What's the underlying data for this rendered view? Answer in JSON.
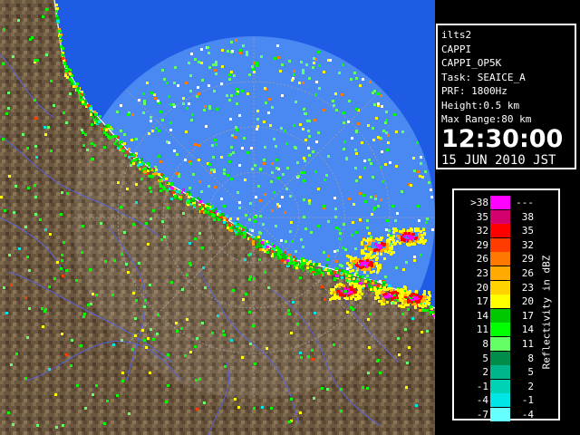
{
  "info": {
    "station": "ilts2",
    "product": "CAPPI",
    "product_code": "CAPPI_OP5K",
    "task": "Task: SEAICE_A",
    "prf": "PRF: 1800Hz",
    "height": "Height:0.5 km",
    "max_range": "Max Range:80 km",
    "time": "12:30:00",
    "date": "15 JUN 2010 JST"
  },
  "legend": {
    "title": "Reflectivity in dBZ",
    "rows": [
      {
        "lo": ">38",
        "hi": "---",
        "color": "#ff00ff"
      },
      {
        "lo": "35",
        "hi": "38",
        "color": "#d4006e"
      },
      {
        "lo": "32",
        "hi": "35",
        "color": "#ff0000"
      },
      {
        "lo": "29",
        "hi": "32",
        "color": "#ff3c00"
      },
      {
        "lo": "26",
        "hi": "29",
        "color": "#ff7800"
      },
      {
        "lo": "23",
        "hi": "26",
        "color": "#ffaa00"
      },
      {
        "lo": "20",
        "hi": "23",
        "color": "#ffd200"
      },
      {
        "lo": "17",
        "hi": "20",
        "color": "#ffff00"
      },
      {
        "lo": "14",
        "hi": "17",
        "color": "#00c800"
      },
      {
        "lo": "11",
        "hi": "14",
        "color": "#00ff00"
      },
      {
        "lo": "8",
        "hi": "11",
        "color": "#64ff64"
      },
      {
        "lo": "5",
        "hi": "8",
        "color": "#008c4b"
      },
      {
        "lo": "2",
        "hi": "5",
        "color": "#00b48c"
      },
      {
        "lo": "-1",
        "hi": "2",
        "color": "#00d2b4"
      },
      {
        "lo": "-4",
        "hi": "-1",
        "color": "#00e6e6"
      },
      {
        "lo": "-7",
        "hi": "-4",
        "color": "#66ffff"
      }
    ]
  },
  "map": {
    "sea_color": "#1e5ce6",
    "range_color": "#4a88f2",
    "land_color": "#6e5a40",
    "river_color": "#5a64dc",
    "grid_color": "#a0a0a0"
  }
}
